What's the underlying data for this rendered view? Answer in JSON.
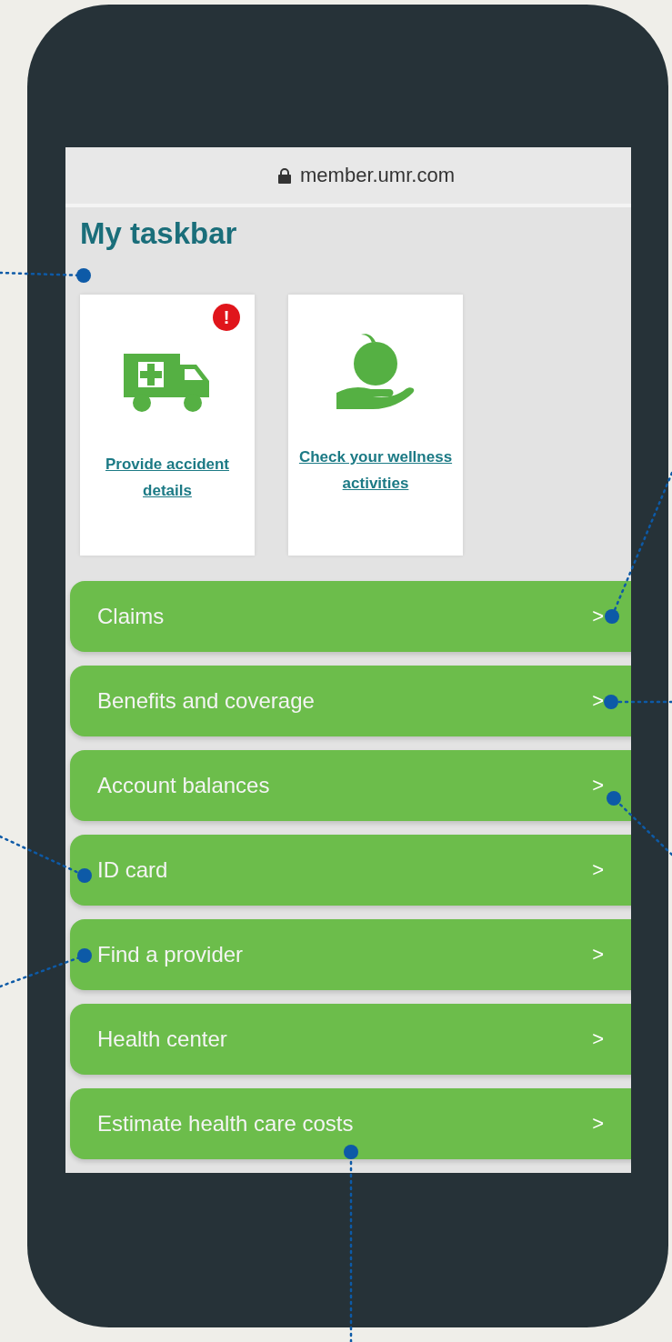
{
  "address_bar": {
    "url": "member.umr.com"
  },
  "taskbar": {
    "title": "My taskbar",
    "tasks": [
      {
        "kind": "ambulance",
        "label": "Provide accident details",
        "badge": "!"
      },
      {
        "kind": "apple",
        "label": "Check your wellness activities"
      }
    ]
  },
  "menu": [
    {
      "label": "Claims",
      "chevron": ">"
    },
    {
      "label": "Benefits and coverage",
      "chevron": ">"
    },
    {
      "label": "Account balances",
      "chevron": ">"
    },
    {
      "label": "ID card",
      "chevron": ">"
    },
    {
      "label": "Find a provider",
      "chevron": ">"
    },
    {
      "label": "Health center",
      "chevron": ">"
    },
    {
      "label": "Estimate health care costs",
      "chevron": ">"
    }
  ]
}
